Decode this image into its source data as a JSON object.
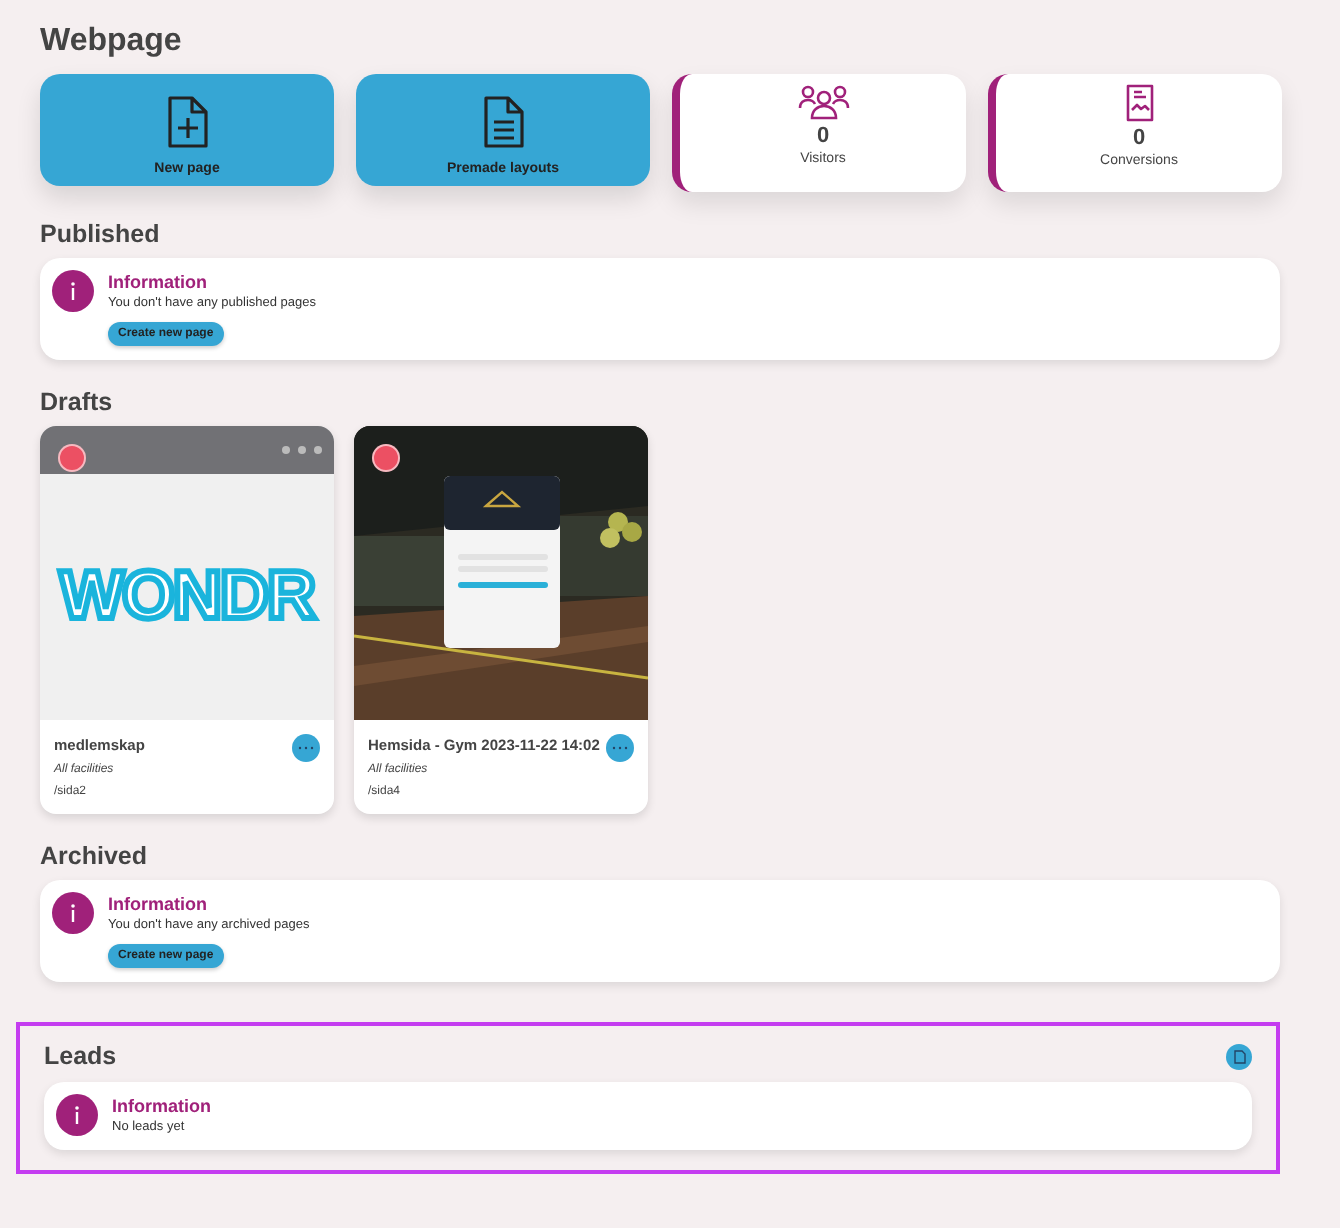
{
  "title": "Webpage",
  "actions": [
    {
      "label": "New page"
    },
    {
      "label": "Premade layouts"
    }
  ],
  "stats": [
    {
      "value": "0",
      "label": "Visitors"
    },
    {
      "value": "0",
      "label": "Conversions"
    }
  ],
  "published": {
    "heading": "Published",
    "info": {
      "title": "Information",
      "message": "You don't have any published pages"
    },
    "button": "Create new page"
  },
  "drafts": {
    "heading": "Drafts",
    "cards": [
      {
        "title": "medlemskap",
        "facility": "All facilities",
        "path": "/sida2",
        "preview": {
          "kind": "page",
          "logo": "WONDR"
        }
      },
      {
        "title": "Hemsida - Gym 2023-11-22 14:02",
        "facility": "All facilities",
        "path": "/sida4"
      }
    ]
  },
  "archived": {
    "heading": "Archived",
    "info": {
      "title": "Information",
      "message": "You don't have any archived pages"
    },
    "button": "Create new page"
  },
  "leads": {
    "heading": "Leads",
    "highlighted": true,
    "info": {
      "title": "Information",
      "message": "No leads yet"
    }
  }
}
